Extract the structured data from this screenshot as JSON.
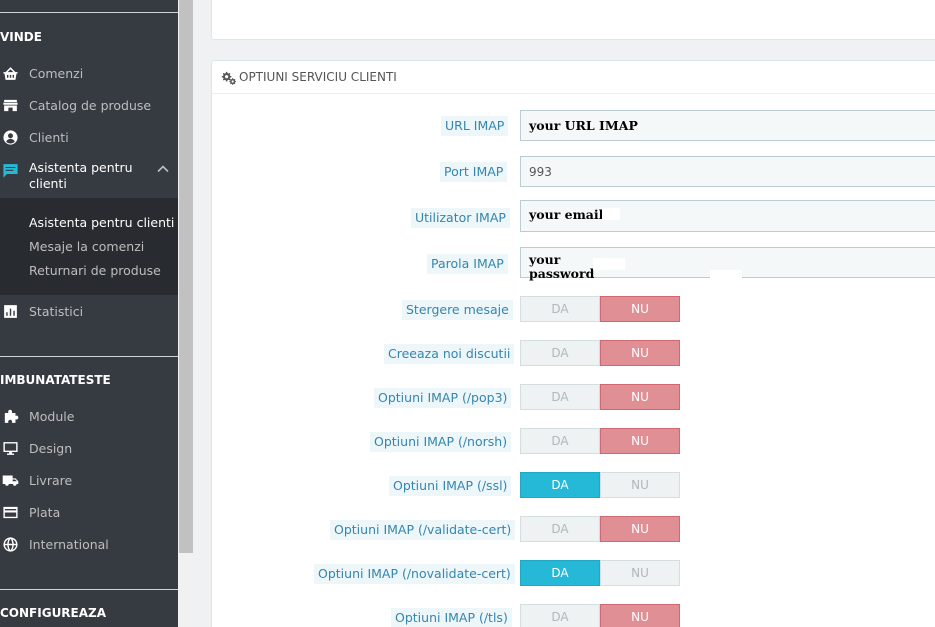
{
  "sidebar": {
    "section_sell": "VINDE",
    "section_improve": "IMBUNATATESTE",
    "section_configure": "CONFIGUREAZA",
    "items": [
      {
        "label": "Comenzi",
        "icon": "basket-icon"
      },
      {
        "label": "Catalog de produse",
        "icon": "store-icon"
      },
      {
        "label": "Clienti",
        "icon": "user-circle-icon"
      }
    ],
    "active_item": {
      "label": "Asistenta pentru clienti",
      "icon": "chat-icon"
    },
    "subitems": [
      {
        "label": "Asistenta pentru clienti",
        "current": true
      },
      {
        "label": "Mesaje la comenzi",
        "current": false
      },
      {
        "label": "Returnari de produse",
        "current": false
      }
    ],
    "stats": {
      "label": "Statistici",
      "icon": "bar-chart-icon"
    },
    "improve_items": [
      {
        "label": "Module",
        "icon": "puzzle-icon"
      },
      {
        "label": "Design",
        "icon": "monitor-icon"
      },
      {
        "label": "Livrare",
        "icon": "truck-icon"
      },
      {
        "label": "Plata",
        "icon": "credit-card-icon"
      },
      {
        "label": "International",
        "icon": "globe-icon"
      }
    ]
  },
  "panel": {
    "title": "OPTIUNI SERVICIU CLIENTI",
    "title_icon": "cogs-icon"
  },
  "fields": {
    "url_imap": {
      "label": "URL IMAP",
      "value": "your URL IMAP"
    },
    "port_imap": {
      "label": "Port IMAP",
      "value": "993"
    },
    "user_imap": {
      "label": "Utilizator IMAP",
      "value": "your email"
    },
    "pass_imap": {
      "label": "Parola IMAP",
      "value_line1": "your",
      "value_line2": "password"
    }
  },
  "switches": {
    "on_label": "DA",
    "off_label": "NU",
    "items": [
      {
        "label": "Stergere mesaje",
        "value": "NU"
      },
      {
        "label": "Creeaza noi discutii",
        "value": "NU"
      },
      {
        "label": "Optiuni IMAP (/pop3)",
        "value": "NU"
      },
      {
        "label": "Optiuni IMAP (/norsh)",
        "value": "NU"
      },
      {
        "label": "Optiuni IMAP (/ssl)",
        "value": "DA"
      },
      {
        "label": "Optiuni IMAP (/validate-cert)",
        "value": "NU"
      },
      {
        "label": "Optiuni IMAP (/novalidate-cert)",
        "value": "DA"
      },
      {
        "label": "Optiuni IMAP (/tls)",
        "value": "NU"
      }
    ]
  },
  "colors": {
    "sidebar_bg": "#363a41",
    "accent": "#25b9d7",
    "no_active": "#e08f95"
  }
}
